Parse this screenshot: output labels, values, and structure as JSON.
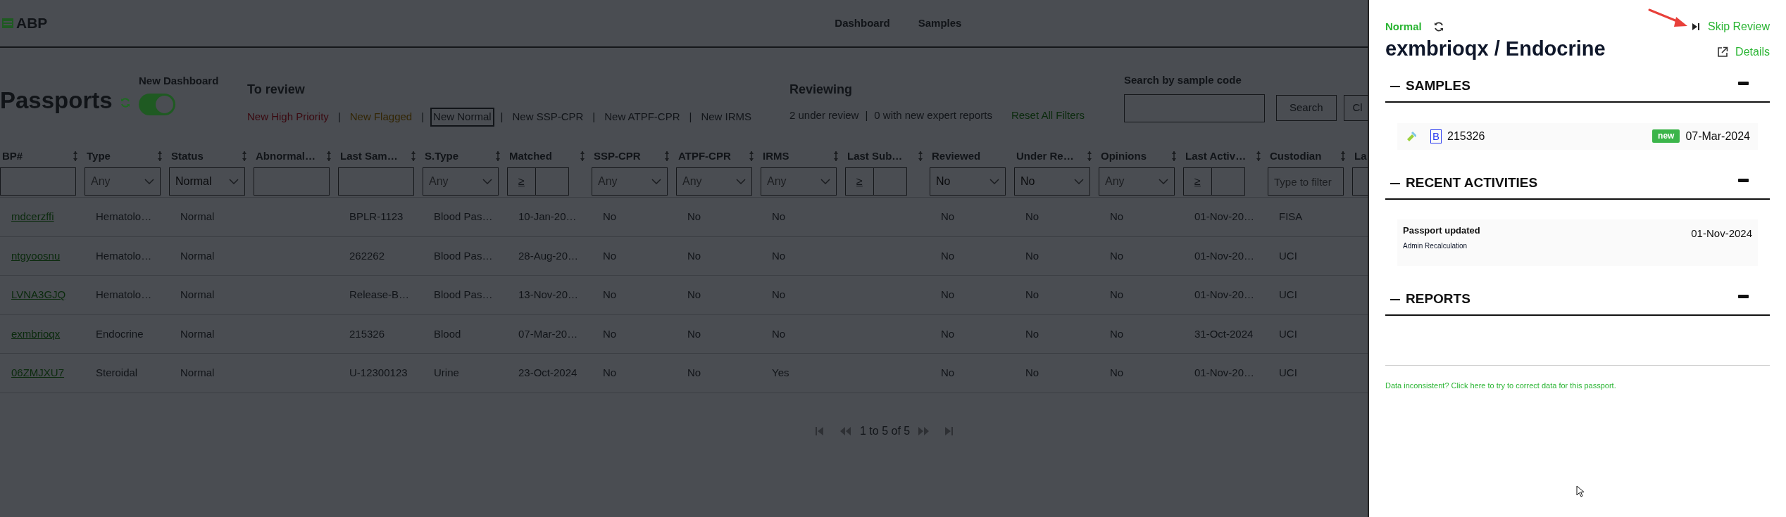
{
  "app": {
    "logo": "ABP"
  },
  "nav": [
    {
      "label": "Dashboard"
    },
    {
      "label": "Samples"
    }
  ],
  "page": {
    "title": "Passports",
    "toggle": {
      "label": "New Dashboard",
      "on": true
    }
  },
  "to_review": {
    "heading": "To review",
    "separator": "|",
    "filters": [
      {
        "label": "New High Priority",
        "color": "#3a0910",
        "selected": false
      },
      {
        "label": "New Flagged",
        "color": "#332604",
        "selected": false
      },
      {
        "label": "New Normal",
        "color": "#111418",
        "selected": true
      },
      {
        "label": "New SSP-CPR",
        "color": "#111418",
        "selected": false
      },
      {
        "label": "New ATPF-CPR",
        "color": "#111418",
        "selected": false
      },
      {
        "label": "New IRMS",
        "color": "#111418",
        "selected": false
      }
    ]
  },
  "reviewing": {
    "heading": "Reviewing",
    "separator": "|",
    "stats": [
      "2 under review",
      "0 with new expert reports"
    ],
    "reset": "Reset All Filters"
  },
  "search": {
    "label": "Search by sample code",
    "buttons": [
      "Search",
      "Cl"
    ]
  },
  "table": {
    "columns": [
      {
        "label": "BP#",
        "sortable": true,
        "filter": {
          "kind": "text"
        }
      },
      {
        "label": "Type",
        "sortable": true,
        "filter": {
          "kind": "select",
          "placeholder": "Any"
        }
      },
      {
        "label": "Status",
        "sortable": true,
        "filter": {
          "kind": "select",
          "value": "Normal"
        }
      },
      {
        "label": "Abnormal…",
        "sortable": true,
        "filter": {
          "kind": "text"
        }
      },
      {
        "label": "Last Sam…",
        "sortable": true,
        "filter": {
          "kind": "text"
        }
      },
      {
        "label": "S.Type",
        "sortable": true,
        "filter": {
          "kind": "select",
          "placeholder": "Any"
        }
      },
      {
        "label": "Matched",
        "sortable": true,
        "filter": {
          "kind": "compare",
          "op": "≥"
        }
      },
      {
        "label": "SSP-CPR",
        "sortable": true,
        "filter": {
          "kind": "select",
          "placeholder": "Any"
        }
      },
      {
        "label": "ATPF-CPR",
        "sortable": true,
        "filter": {
          "kind": "select",
          "placeholder": "Any"
        }
      },
      {
        "label": "IRMS",
        "sortable": true,
        "filter": {
          "kind": "select",
          "placeholder": "Any"
        }
      },
      {
        "label": "Last Sub…",
        "sortable": true,
        "filter": {
          "kind": "compare",
          "op": "≥"
        }
      },
      {
        "label": "Reviewed",
        "sortable": false,
        "filter": {
          "kind": "select",
          "value": "No"
        }
      },
      {
        "label": "Under Re…",
        "sortable": true,
        "filter": {
          "kind": "select",
          "value": "No"
        }
      },
      {
        "label": "Opinions",
        "sortable": true,
        "filter": {
          "kind": "select",
          "placeholder": "Any"
        }
      },
      {
        "label": "Last Activ…",
        "sortable": true,
        "filter": {
          "kind": "compare",
          "op": "≥"
        }
      },
      {
        "label": "Custodian",
        "sortable": true,
        "filter": {
          "kind": "text",
          "placeholder": "Type to filter"
        }
      },
      {
        "label": "La",
        "sortable": false,
        "filter": {
          "kind": "text"
        }
      }
    ],
    "rows": [
      {
        "bp": "mdcerzffi",
        "type": "Hematolo…",
        "status": "Normal",
        "last_sample": "BPLR-1123",
        "s_type": "Blood Pas…",
        "matched": "10-Jan-20…",
        "ssp_cpr": "No",
        "atpf_cpr": "No",
        "irms": "No",
        "reviewed": "No",
        "under_review": "No",
        "opinions": "No",
        "last_activity": "01-Nov-20…",
        "custodian": "FISA"
      },
      {
        "bp": "ntgyoosnu",
        "type": "Hematolo…",
        "status": "Normal",
        "last_sample": "262262",
        "s_type": "Blood Pas…",
        "matched": "28-Aug-20…",
        "ssp_cpr": "No",
        "atpf_cpr": "No",
        "irms": "No",
        "reviewed": "No",
        "under_review": "No",
        "opinions": "No",
        "last_activity": "01-Nov-20…",
        "custodian": "UCI"
      },
      {
        "bp": "LVNA3GJQ",
        "type": "Hematolo…",
        "status": "Normal",
        "last_sample": "Release-B…",
        "s_type": "Blood Pas…",
        "matched": "13-Nov-20…",
        "ssp_cpr": "No",
        "atpf_cpr": "No",
        "irms": "No",
        "reviewed": "No",
        "under_review": "No",
        "opinions": "No",
        "last_activity": "01-Nov-20…",
        "custodian": "UCI"
      },
      {
        "bp": "exmbrioqx",
        "type": "Endocrine",
        "status": "Normal",
        "last_sample": "215326",
        "s_type": "Blood",
        "matched": "07-Mar-20…",
        "ssp_cpr": "No",
        "atpf_cpr": "No",
        "irms": "No",
        "reviewed": "No",
        "under_review": "No",
        "opinions": "No",
        "last_activity": "31-Oct-2024",
        "custodian": "UCI"
      },
      {
        "bp": "06ZMJXU7",
        "type": "Steroidal",
        "status": "Normal",
        "last_sample": "U-12300123",
        "s_type": "Urine",
        "matched": "23-Oct-2024",
        "ssp_cpr": "No",
        "atpf_cpr": "No",
        "irms": "Yes",
        "reviewed": "No",
        "under_review": "No",
        "opinions": "No",
        "last_activity": "01-Nov-20…",
        "custodian": "UCI"
      }
    ]
  },
  "pagination": {
    "summary": "1 to 5 of 5"
  },
  "panel": {
    "status": "Normal",
    "title": "exmbrioqx / Endocrine",
    "skip": "Skip Review",
    "details": "Details",
    "sections": [
      {
        "kind": "samples",
        "title": "SAMPLES",
        "items": [
          {
            "letter": "B",
            "code": "215326",
            "badge": "new",
            "date": "07-Mar-2024"
          }
        ]
      },
      {
        "kind": "activities",
        "title": "RECENT ACTIVITIES",
        "items": [
          {
            "title": "Passport updated",
            "detail": "Admin Recalculation",
            "date": "01-Nov-2024"
          }
        ]
      },
      {
        "kind": "reports",
        "title": "REPORTS"
      }
    ],
    "footer_link": "Data inconsistent? Click here to try to correct data for this passport."
  }
}
